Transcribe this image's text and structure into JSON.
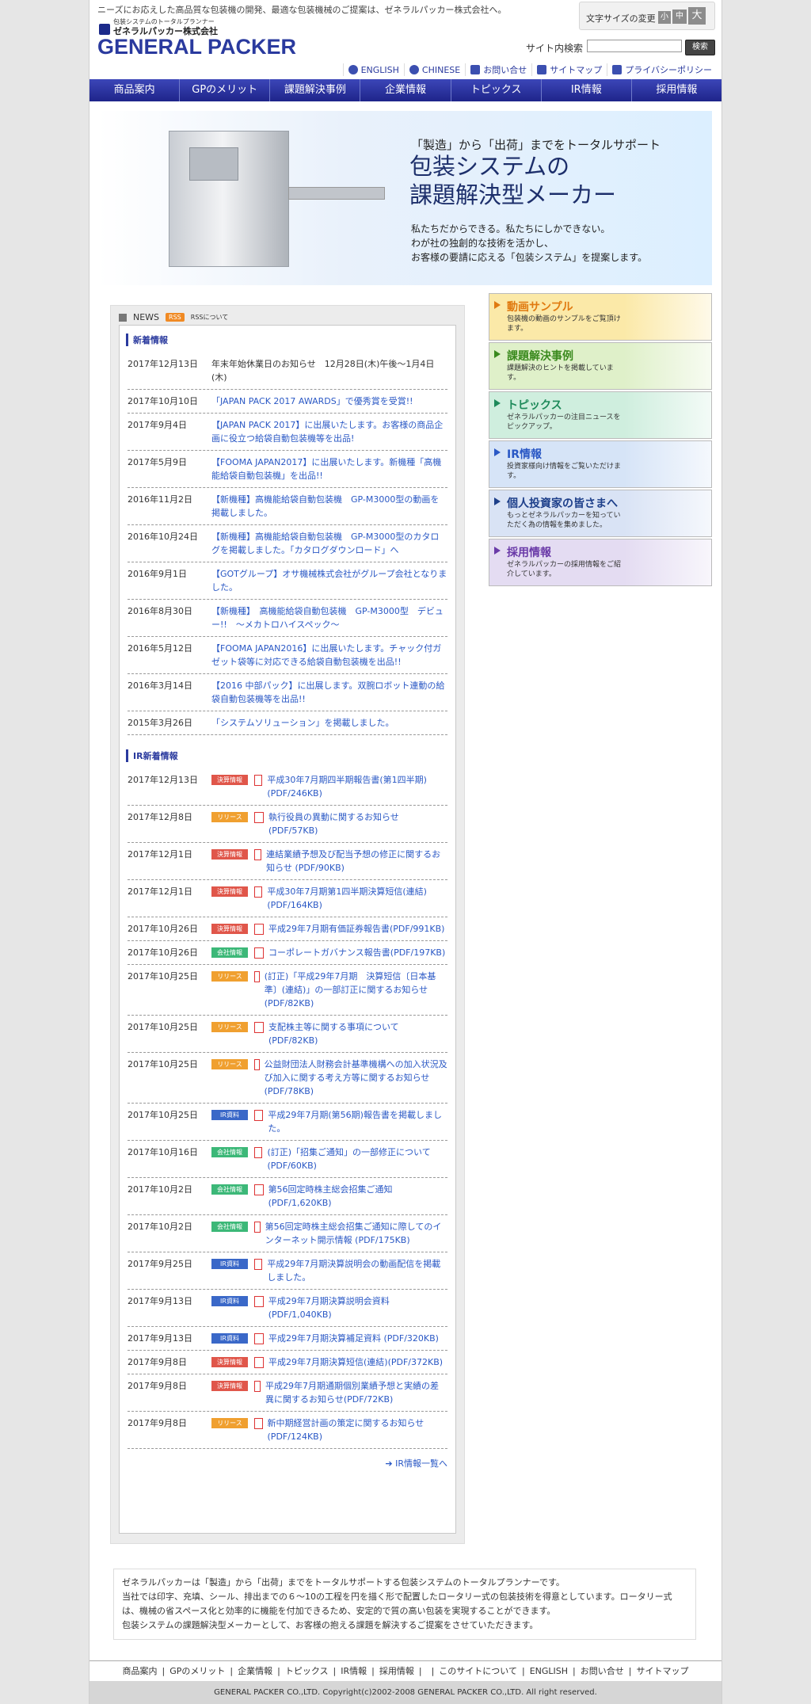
{
  "header": {
    "tagline": "ニーズにお応えした高品質な包装機の開発、最適な包装機械のご提案は、ゼネラルパッカー株式会社へ。",
    "logo_small": "包装システムのトータルプランナー",
    "logo_jp": "ゼネラルパッカー株式会社",
    "logo_en": "GENERAL PACKER",
    "fontsize_label": "文字サイズの変更",
    "fontsize_small": "小",
    "fontsize_medium": "中",
    "fontsize_large": "大",
    "search_label": "サイト内検索",
    "search_value": "",
    "search_button": "検索"
  },
  "util": [
    {
      "label": "ENGLISH",
      "icon": "globe-icon"
    },
    {
      "label": "CHINESE",
      "icon": "globe-icon"
    },
    {
      "label": "お問い合せ",
      "icon": "mail-icon"
    },
    {
      "label": "サイトマップ",
      "icon": "sitemap-icon"
    },
    {
      "label": "プライバシーポリシー",
      "icon": "privacy-icon"
    }
  ],
  "nav": [
    "商品案内",
    "GPのメリット",
    "課題解決事例",
    "企業情報",
    "トピックス",
    "IR情報",
    "採用情報"
  ],
  "hero": {
    "line1": "「製造」から「出荷」までをトータルサポート",
    "line2a": "包装システムの",
    "line2b": "課題解決型メーカー",
    "line3a": "私たちだからできる。私たちにしかできない。",
    "line3b": "わが社の独創的な技術を活かし、",
    "line3c": "お客様の要請に応える「包装システム」を提案します。"
  },
  "news": {
    "label": "NEWS",
    "rss": "RSS",
    "rss_about": "RSSについて",
    "new_title": "新着情報",
    "items": [
      {
        "date": "2017年12月13日",
        "text": "年末年始休業日のお知らせ　12月28日(木)午後〜1月4日(木)",
        "link": false
      },
      {
        "date": "2017年10月10日",
        "text": "「JAPAN PACK 2017 AWARDS」で優秀賞を受賞!!",
        "link": true
      },
      {
        "date": "2017年9月4日",
        "text": "【JAPAN PACK 2017】に出展いたします。お客様の商品企画に役立つ給袋自動包装機等を出品!",
        "link": true
      },
      {
        "date": "2017年5月9日",
        "text": "【FOOMA JAPAN2017】に出展いたします。新機種「高機能給袋自動包装機」を出品!!",
        "link": true
      },
      {
        "date": "2016年11月2日",
        "text": "【新機種】高機能給袋自動包装機　GP-M3000型の動画を掲載しました。",
        "link": true
      },
      {
        "date": "2016年10月24日",
        "text": "【新機種】高機能給袋自動包装機　GP-M3000型のカタログを掲載しました。「カタログダウンロード」へ",
        "link": true
      },
      {
        "date": "2016年9月1日",
        "text": "【GOTグループ】オサ機械株式会社がグループ会社となりました。",
        "link": true
      },
      {
        "date": "2016年8月30日",
        "text": "【新機種】　高機能給袋自動包装機　GP-M3000型　デビュー!!　〜メカトロハイスペック〜",
        "link": true
      },
      {
        "date": "2016年5月12日",
        "text": "【FOOMA JAPAN2016】に出展いたします。チャック付ガゼット袋等に対応できる給袋自動包装機を出品!!",
        "link": true
      },
      {
        "date": "2016年3月14日",
        "text": "【2016 中部パック】に出展します。双腕ロボット連動の給袋自動包装機等を出品!!",
        "link": true
      },
      {
        "date": "2015年3月26日",
        "text": "「システムソリューション」を掲載しました。",
        "link": true
      }
    ],
    "ir_title": "IR新着情報",
    "ir_items": [
      {
        "date": "2017年12月13日",
        "tag": "決算情報",
        "color": "#e0564a",
        "text": "平成30年7月期四半期報告書(第1四半期)(PDF/246KB)"
      },
      {
        "date": "2017年12月8日",
        "tag": "リリース",
        "color": "#f0a030",
        "text": "執行役員の異動に関するお知らせ(PDF/57KB)"
      },
      {
        "date": "2017年12月1日",
        "tag": "決算情報",
        "color": "#e0564a",
        "text": "連結業績予想及び配当予想の修正に関するお知らせ (PDF/90KB)"
      },
      {
        "date": "2017年12月1日",
        "tag": "決算情報",
        "color": "#e0564a",
        "text": "平成30年7月期第1四半期決算短信(連結)(PDF/164KB)"
      },
      {
        "date": "2017年10月26日",
        "tag": "決算情報",
        "color": "#e0564a",
        "text": "平成29年7月期有価証券報告書(PDF/991KB)"
      },
      {
        "date": "2017年10月26日",
        "tag": "会社情報",
        "color": "#3cb878",
        "text": "コーポレートガバナンス報告書(PDF/197KB)"
      },
      {
        "date": "2017年10月25日",
        "tag": "リリース",
        "color": "#f0a030",
        "text": "(訂正)「平成29年7月期　決算短信〔日本基準〕(連結)」の一部訂正に関するお知らせ(PDF/82KB)"
      },
      {
        "date": "2017年10月25日",
        "tag": "リリース",
        "color": "#f0a030",
        "text": "支配株主等に関する事項について(PDF/82KB)"
      },
      {
        "date": "2017年10月25日",
        "tag": "リリース",
        "color": "#f0a030",
        "text": "公益財団法人財務会計基準機構への加入状況及び加入に関する考え方等に関するお知らせ(PDF/78KB)"
      },
      {
        "date": "2017年10月25日",
        "tag": "IR資料",
        "color": "#3a68c8",
        "text": "平成29年7月期(第56期)報告書を掲載しました。"
      },
      {
        "date": "2017年10月16日",
        "tag": "会社情報",
        "color": "#3cb878",
        "text": "(訂正)「招集ご通知」の一部修正について(PDF/60KB)"
      },
      {
        "date": "2017年10月2日",
        "tag": "会社情報",
        "color": "#3cb878",
        "text": "第56回定時株主総会招集ご通知(PDF/1,620KB)"
      },
      {
        "date": "2017年10月2日",
        "tag": "会社情報",
        "color": "#3cb878",
        "text": "第56回定時株主総会招集ご通知に際してのインターネット開示情報 (PDF/175KB)"
      },
      {
        "date": "2017年9月25日",
        "tag": "IR資料",
        "color": "#3a68c8",
        "text": "平成29年7月期決算説明会の動画配信を掲載しました。"
      },
      {
        "date": "2017年9月13日",
        "tag": "IR資料",
        "color": "#3a68c8",
        "text": "平成29年7月期決算説明会資料(PDF/1,040KB)"
      },
      {
        "date": "2017年9月13日",
        "tag": "IR資料",
        "color": "#3a68c8",
        "text": "平成29年7月期決算補足資料 (PDF/320KB)"
      },
      {
        "date": "2017年9月8日",
        "tag": "決算情報",
        "color": "#e0564a",
        "text": "平成29年7月期決算短信(連結)(PDF/372KB)"
      },
      {
        "date": "2017年9月8日",
        "tag": "決算情報",
        "color": "#e0564a",
        "text": "平成29年7月期通期個別業績予想と実績の差異に関するお知らせ(PDF/72KB)"
      },
      {
        "date": "2017年9月8日",
        "tag": "リリース",
        "color": "#f0a030",
        "text": "新中期経営計画の策定に関するお知らせ(PDF/124KB)"
      }
    ],
    "ir_more": "IR情報一覧へ"
  },
  "side": [
    {
      "title": "動画サンプル",
      "desc": "包装機の動画のサンプルをご覧頂けます。",
      "bg": "#fbe9a8",
      "color": "#e07a10",
      "arrow": "#e07a10"
    },
    {
      "title": "課題解決事例",
      "desc": "課題解決のヒントを掲載しています。",
      "bg": "#dff0c9",
      "color": "#3a8a1e",
      "arrow": "#3a8a1e"
    },
    {
      "title": "トピックス",
      "desc": "ゼネラルパッカーの注目ニュースをピックアップ。",
      "bg": "#cfeede",
      "color": "#1e8a5a",
      "arrow": "#1e8a5a"
    },
    {
      "title": "IR情報",
      "desc": "投資家様向け情報をご覧いただけます。",
      "bg": "#d6e4f7",
      "color": "#2a58c5",
      "arrow": "#2a58c5"
    },
    {
      "title": "個人投資家の皆さまへ",
      "desc": "もっとゼネラルパッカーを知っていただく為の情報を集めました。",
      "bg": "#d9e3f5",
      "color": "#1d3f8a",
      "arrow": "#1d3f8a"
    },
    {
      "title": "採用情報",
      "desc": "ゼネラルパッカーの採用情報をご紹介しています。",
      "bg": "#e4dcf2",
      "color": "#6a3aa8",
      "arrow": "#6a3aa8"
    }
  ],
  "intro": [
    "ゼネラルパッカーは「製造」から「出荷」までをトータルサポートする包装システムのトータルプランナーです。",
    "当社では印字、充填、シール、排出までの６〜10の工程を円を描く形で配置したロータリー式の包装技術を得意としています。ロータリー式は、機械の省スペース化と効率的に機能を付加できるため、安定的で質の高い包装を実現することができます。",
    "包装システムの課題解決型メーカーとして、お客様の抱える課題を解決するご提案をさせていただきます。"
  ],
  "footer_nav": [
    "商品案内",
    "GPのメリット",
    "企業情報",
    "トピックス",
    "IR情報",
    "採用情報",
    "",
    "このサイトについて",
    "ENGLISH",
    "お問い合せ",
    "サイトマップ"
  ],
  "copyright": "GENERAL PACKER CO.,LTD. Copyright(c)2002-2008 GENERAL PACKER CO.,LTD. All right reserved."
}
